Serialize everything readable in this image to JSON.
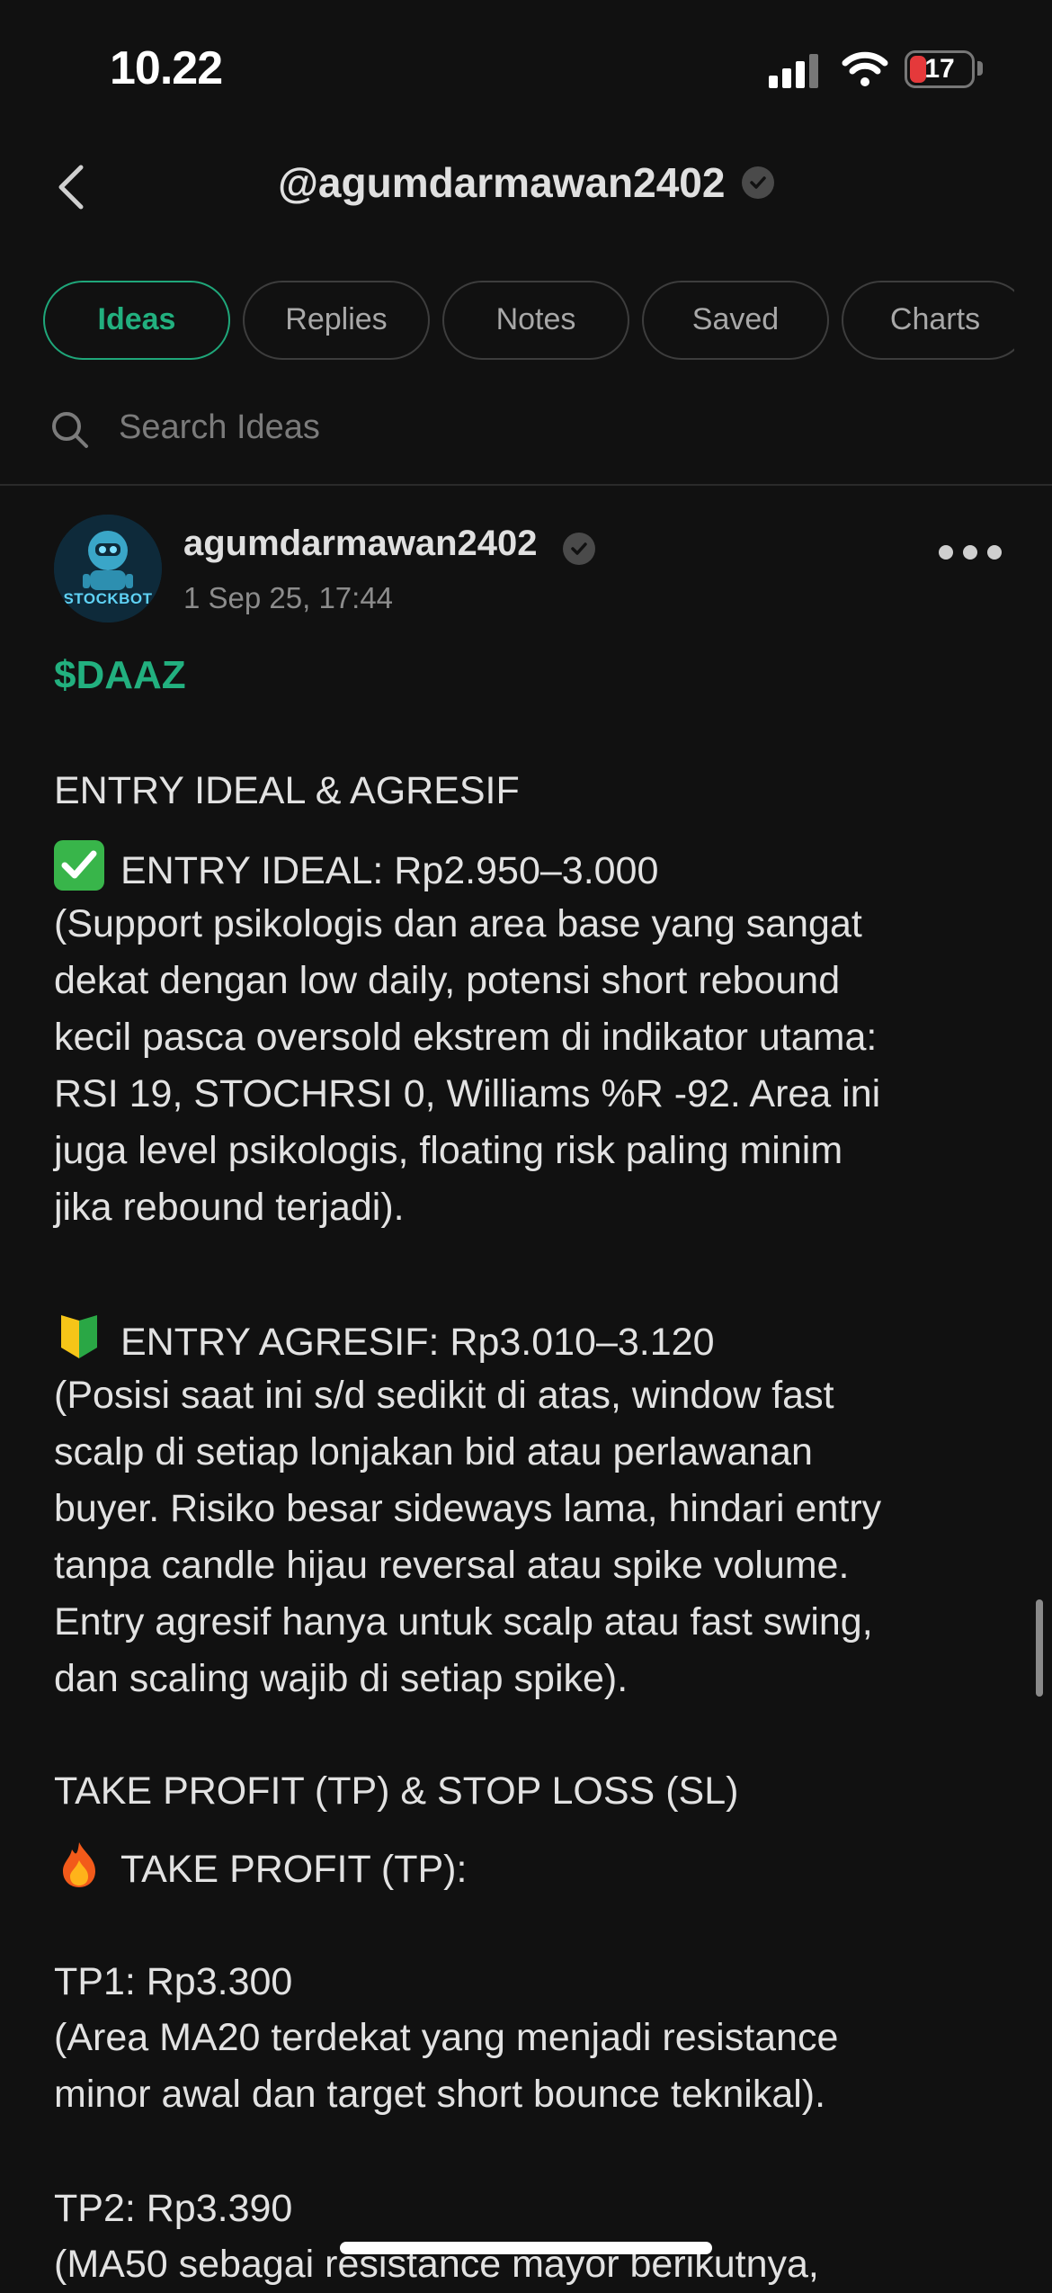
{
  "status_bar": {
    "time": "10.22",
    "battery": "17"
  },
  "header": {
    "title": "@agumdarmawan2402"
  },
  "tabs": [
    {
      "label": "Ideas",
      "active": true
    },
    {
      "label": "Replies",
      "active": false
    },
    {
      "label": "Notes",
      "active": false
    },
    {
      "label": "Saved",
      "active": false
    },
    {
      "label": "Charts",
      "active": false
    }
  ],
  "search": {
    "placeholder": "Search Ideas"
  },
  "post": {
    "author": "agumdarmawan2402",
    "avatar_text": "STOCKBOT",
    "date": "1 Sep 25, 17:44",
    "ticker": "$DAAZ",
    "section1_title": "ENTRY IDEAL & AGRESIF",
    "entry_ideal_title": "ENTRY IDEAL: Rp2.950–3.000",
    "entry_ideal_lines": [
      "(Support psikologis dan area base yang sangat",
      "dekat dengan low daily, potensi short rebound",
      "kecil pasca oversold ekstrem di indikator utama:",
      "RSI 19, STOCHRSI 0, Williams %R -92. Area ini",
      "juga level psikologis, floating risk paling minim",
      "jika rebound terjadi)."
    ],
    "entry_agresif_title": "ENTRY AGRESIF: Rp3.010–3.120",
    "entry_agresif_lines": [
      "(Posisi saat ini s/d sedikit di atas, window fast",
      "scalp di setiap lonjakan bid atau perlawanan",
      "buyer. Risiko besar sideways lama, hindari entry",
      "tanpa candle hijau reversal atau spike volume.",
      "Entry agresif hanya untuk scalp atau fast swing,",
      "dan scaling wajib di setiap spike)."
    ],
    "section2_title": "TAKE PROFIT (TP) & STOP LOSS (SL)",
    "tp_title": "TAKE PROFIT (TP):",
    "tp1_title": "TP1: Rp3.300",
    "tp1_lines": [
      "(Area MA20 terdekat yang menjadi resistance",
      "minor awal dan target short bounce teknikal)."
    ],
    "tp2_title": "TP2: Rp3.390",
    "tp2_line": "(MA50 sebagai resistance mayor berikutnya,"
  },
  "colors": {
    "accent": "#22b07f",
    "background": "#111111"
  }
}
